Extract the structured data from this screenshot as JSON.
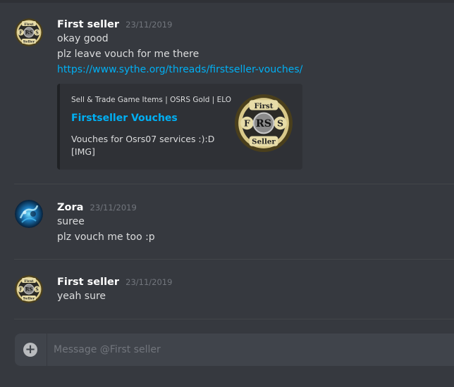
{
  "messages": [
    {
      "author": "First seller",
      "timestamp": "23/11/2019",
      "lines": [
        "okay good",
        "plz leave vouch for me there"
      ],
      "link": "https://www.sythe.org/threads/firstseller-vouches/",
      "embed": {
        "provider": "Sell & Trade Game Items | OSRS Gold | ELO",
        "title": "Firstseller Vouches",
        "description": [
          "Vouches for Osrs07 services :):D",
          "[IMG]"
        ],
        "thumbnail_logo": {
          "top": "First",
          "left": "F",
          "right": "S",
          "center": "RS",
          "bottom": "Seller"
        }
      }
    },
    {
      "author": "Zora",
      "timestamp": "23/11/2019",
      "lines": [
        "suree",
        "plz vouch me too :p"
      ]
    },
    {
      "author": "First seller",
      "timestamp": "23/11/2019",
      "lines": [
        "yeah sure"
      ]
    }
  ],
  "composer": {
    "placeholder": "Message @First seller",
    "add_button_icon": "plus-icon"
  },
  "avatar_logo": {
    "top": "First",
    "left": "F",
    "right": "S",
    "center": "RS",
    "bottom": "Seller"
  }
}
